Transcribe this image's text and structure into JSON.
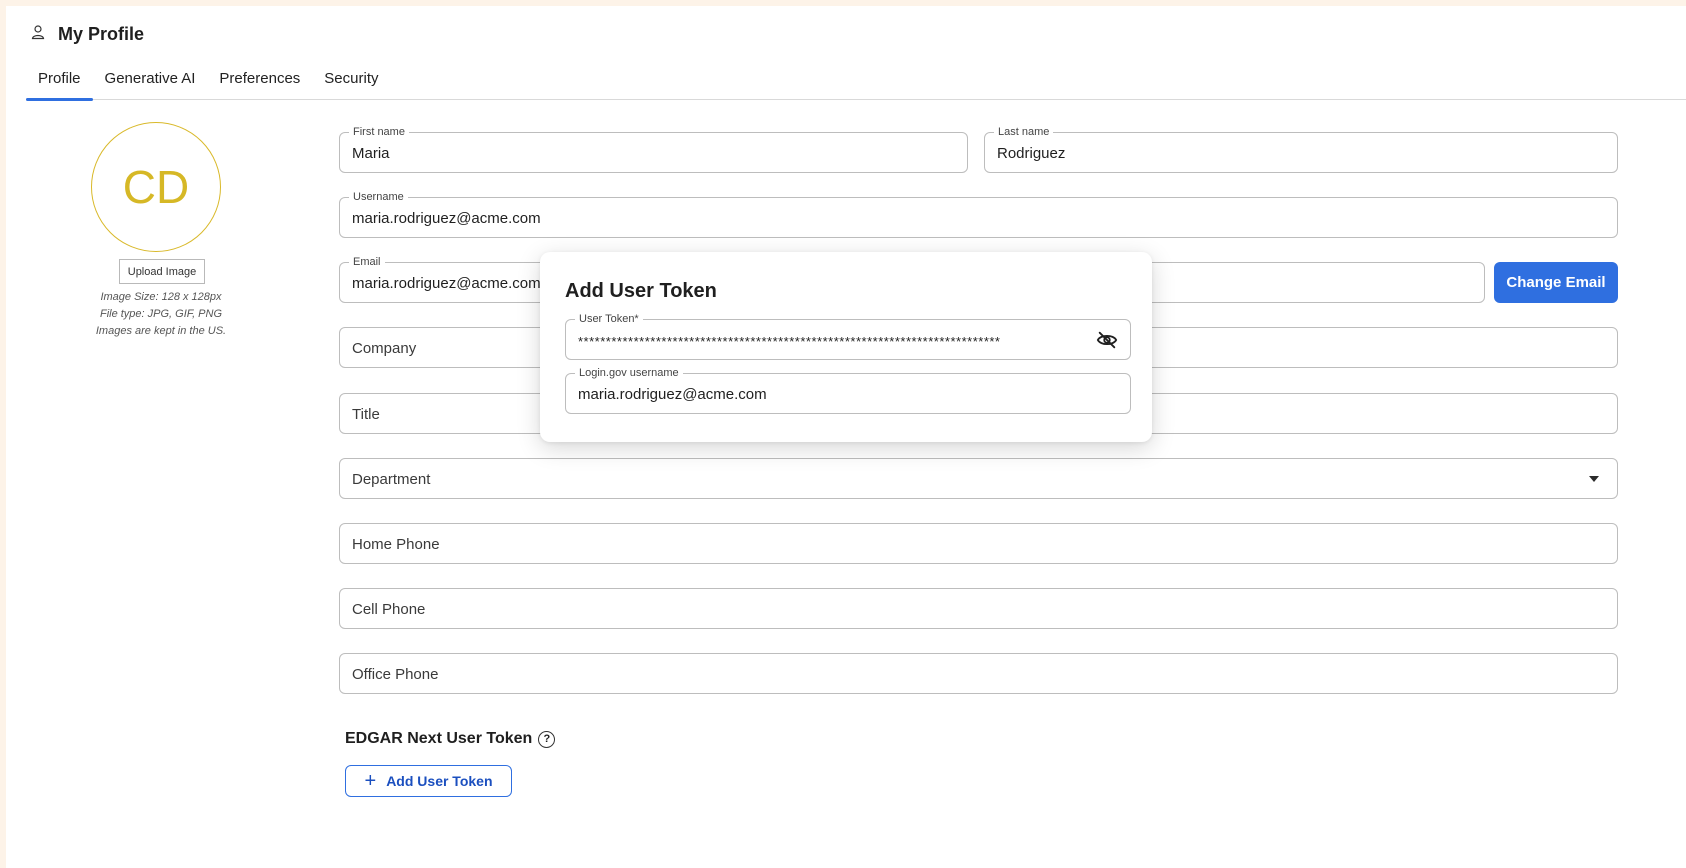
{
  "header": {
    "title": "My Profile",
    "icon": "user-icon"
  },
  "tabs": [
    {
      "label": "Profile",
      "active": true
    },
    {
      "label": "Generative AI",
      "active": false
    },
    {
      "label": "Preferences",
      "active": false
    },
    {
      "label": "Security",
      "active": false
    }
  ],
  "avatar": {
    "initials": "CD",
    "upload_label": "Upload Image",
    "info": [
      "Image Size: 128 x 128px",
      "File type: JPG, GIF, PNG",
      "Images are kept in the US."
    ]
  },
  "form": {
    "first_name": {
      "label": "First name",
      "value": "Maria"
    },
    "last_name": {
      "label": "Last name",
      "value": "Rodriguez"
    },
    "username": {
      "label": "Username",
      "value": "maria.rodriguez@acme.com"
    },
    "email": {
      "label": "Email",
      "value": "maria.rodriguez@acme.com"
    },
    "change_email_label": "Change Email",
    "company": {
      "placeholder": "Company"
    },
    "title": {
      "placeholder": "Title"
    },
    "department": {
      "placeholder": "Department"
    },
    "home_phone": {
      "placeholder": "Home Phone"
    },
    "cell_phone": {
      "placeholder": "Cell Phone"
    },
    "office_phone": {
      "placeholder": "Office Phone"
    }
  },
  "token_section": {
    "title": "EDGAR Next User Token",
    "help_glyph": "?",
    "add_plus": "+",
    "add_label": "Add User Token"
  },
  "modal": {
    "title": "Add User Token",
    "token_label": "User Token*",
    "token_value": "****************************************************************************",
    "login_label": "Login.gov username",
    "login_value": "maria.rodriguez@acme.com"
  },
  "colors": {
    "accent": "#2f6fe0",
    "avatar": "#d6b826",
    "background": "#fdf3e8"
  }
}
